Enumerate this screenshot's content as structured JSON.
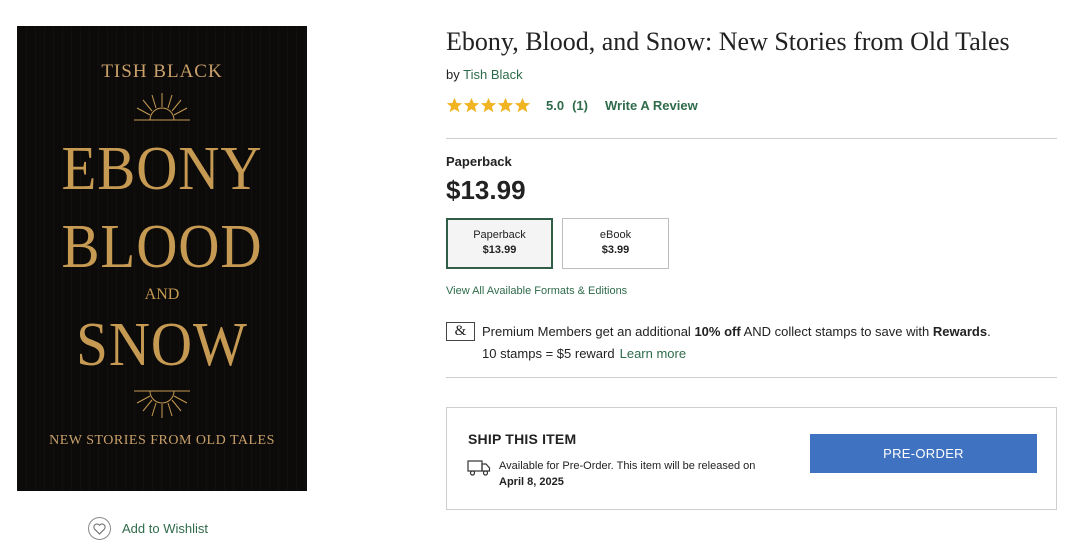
{
  "cover": {
    "author": "TISH BLACK",
    "word1": "EBONY",
    "word2": "BLOOD",
    "word3": "AND",
    "word4": "SNOW",
    "subtitle": "NEW STORIES FROM OLD TALES"
  },
  "wishlist": {
    "label": "Add to Wishlist",
    "icon": "heart-icon"
  },
  "product": {
    "title": "Ebony, Blood, and Snow: New Stories from Old Tales",
    "by_prefix": "by",
    "author": "Tish Black",
    "rating": {
      "stars": 5,
      "score": "5.0",
      "count": "(1)",
      "review_link": "Write A Review",
      "star_color": "#f0b322"
    },
    "selected_format": "Paperback",
    "price": "$13.99",
    "formats": [
      {
        "name": "Paperback",
        "price": "$13.99",
        "selected": true
      },
      {
        "name": "eBook",
        "price": "$3.99",
        "selected": false
      }
    ],
    "formats_link": "View All Available Formats & Editions"
  },
  "membership": {
    "icon_text": "&",
    "text_before": "Premium Members get an additional ",
    "discount": "10% off",
    "text_middle": " AND collect stamps to save with ",
    "rewards": "Rewards",
    "text_end": ".",
    "stamps_text": "10 stamps = $5 reward",
    "learn_more": "Learn more"
  },
  "shipping": {
    "title": "SHIP THIS ITEM",
    "availability": "Available for Pre-Order. This item will be released on",
    "release_date": "April 8, 2025",
    "button": "PRE-ORDER",
    "button_color": "#3f72c1"
  },
  "colors": {
    "link_green": "#2f6b4a",
    "cover_gold": "#c69a52",
    "cover_bg": "#0c0b09"
  }
}
